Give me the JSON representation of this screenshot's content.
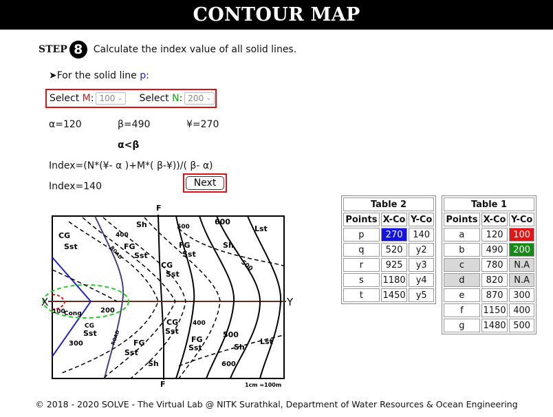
{
  "header": {
    "title": "CONTOUR MAP"
  },
  "step": {
    "label": "STEP",
    "number": "8",
    "instruction": "Calculate the index value of all solid lines."
  },
  "solid_line": {
    "prefix": "➤For the solid line ",
    "point": "p",
    "suffix": ":"
  },
  "selectors": {
    "m": {
      "label_prefix": "Select ",
      "letter": "M",
      "colon": ":",
      "value": "100"
    },
    "n": {
      "label_prefix": "Select ",
      "letter": "N",
      "colon": ":",
      "value": "200"
    }
  },
  "values": {
    "alpha": "α=120",
    "beta": "β=490",
    "yen": "¥=270"
  },
  "comparison": "α<β",
  "formula": "Index=(N*(¥- α )+M*( β-¥))/( β- α)",
  "index_result": "Index=140",
  "next_label": "Next",
  "table2": {
    "title": "Table 2",
    "headers": [
      "Points",
      "X-Co",
      "Y-Co"
    ],
    "rows": [
      [
        "p",
        "270",
        "140"
      ],
      [
        "q",
        "520",
        "y2"
      ],
      [
        "r",
        "925",
        "y3"
      ],
      [
        "s",
        "1180",
        "y4"
      ],
      [
        "t",
        "1450",
        "y5"
      ]
    ]
  },
  "table1": {
    "title": "Table 1",
    "headers": [
      "Points",
      "X-Co",
      "Y-Co"
    ],
    "rows": [
      [
        "a",
        "120",
        "100"
      ],
      [
        "b",
        "490",
        "200"
      ],
      [
        "c",
        "780",
        "N.A"
      ],
      [
        "d",
        "820",
        "N.A"
      ],
      [
        "e",
        "870",
        "300"
      ],
      [
        "f",
        "1150",
        "400"
      ],
      [
        "g",
        "1480",
        "500"
      ]
    ]
  },
  "map": {
    "labels": {
      "f_top": "F",
      "f_bottom": "F",
      "x": "X",
      "y": "Y",
      "scale": "1cm =100m",
      "cg1": "CG",
      "sst1": "Sst",
      "sh1": "Sh",
      "c400a": "400",
      "c500a": "500",
      "c600a": "600",
      "lst1": "Lst",
      "fg1": "FG",
      "sst2": "Sst",
      "road1": "ROAD",
      "fg2": "FG",
      "sst3": "Sst",
      "sh2": "Sh",
      "cg2": "CG",
      "sst4": "Sst",
      "c500b": "500",
      "c100": "100",
      "cong": "Cong",
      "c200": "200",
      "cg3": "CG",
      "sst5": "Sst",
      "c300": "300",
      "fg3": "FG",
      "sst6": "Sst",
      "road2": "ROAD",
      "sh3": "Sh",
      "cg4": "CG",
      "sst7": "Sst",
      "c400b": "400",
      "fg4": "FG",
      "sst8": "Sst",
      "c500c": "500",
      "sh4": "Sh",
      "lst2": "Lst",
      "c600b": "600"
    }
  },
  "footer": "© 2018 - 2020 SOLVE - The Virtual Lab @ NITK Surathkal, Department of Water Resources & Ocean Engineering",
  "colors": {
    "header_bg": "#000000",
    "highlight_border": "#dd1111",
    "blue_cell": "#1414e6",
    "red_cell": "#e61414",
    "green_cell": "#148c14",
    "grey_cell": "#d8d8d8"
  }
}
